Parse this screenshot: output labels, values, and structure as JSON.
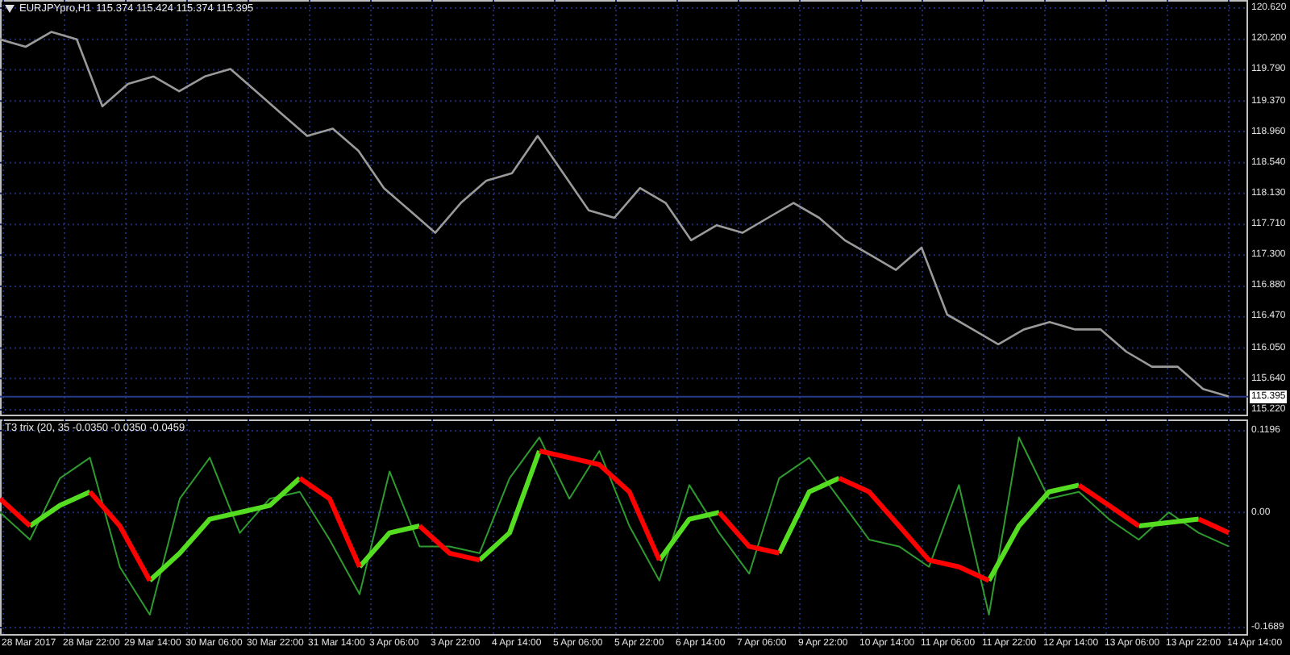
{
  "main_chart": {
    "header": {
      "quotes": "115.374 115.424 115.374 115.395"
    },
    "chart_data": {
      "type": "line",
      "grid": true,
      "ylim": [
        115.22,
        120.62
      ],
      "yticks": [
        {
          "value": 120.62,
          "label": "120.620"
        },
        {
          "value": 120.2,
          "label": "120.200"
        },
        {
          "value": 119.79,
          "label": "119.790"
        },
        {
          "value": 119.37,
          "label": "119.370"
        },
        {
          "value": 118.96,
          "label": "118.960"
        },
        {
          "value": 118.54,
          "label": "118.540"
        },
        {
          "value": 118.13,
          "label": "118.130"
        },
        {
          "value": 117.71,
          "label": "117.710"
        },
        {
          "value": 117.3,
          "label": "117.300"
        },
        {
          "value": 116.88,
          "label": "116.880"
        },
        {
          "value": 116.47,
          "label": "116.470"
        },
        {
          "value": 116.05,
          "label": "116.050"
        },
        {
          "value": 115.64,
          "label": "115.640"
        },
        {
          "value": 115.22,
          "label": "115.220"
        }
      ],
      "ref_lines": [
        {
          "axis": "y",
          "value": 115.395,
          "label": "115.395",
          "color": "#2a3a8a"
        }
      ],
      "series": [
        {
          "name": "EURJPYpro,H1",
          "color": "#9a9a9a",
          "values": [
            120.2,
            120.1,
            120.3,
            120.2,
            119.3,
            119.6,
            119.7,
            119.5,
            119.7,
            119.8,
            119.5,
            119.2,
            118.9,
            119.0,
            118.7,
            118.2,
            117.9,
            117.6,
            118.0,
            118.3,
            118.4,
            118.9,
            118.4,
            117.9,
            117.8,
            118.2,
            118.0,
            117.5,
            117.7,
            117.6,
            117.8,
            118.0,
            117.8,
            117.5,
            117.3,
            117.1,
            117.4,
            116.5,
            116.3,
            116.1,
            116.3,
            116.4,
            116.3,
            116.3,
            116.0,
            115.8,
            115.8,
            115.5,
            115.4
          ]
        }
      ]
    }
  },
  "indicator": {
    "label": "T3 trix (20, 35 -0.0350 -0.0350 -0.0459",
    "chart_data": {
      "type": "line",
      "grid": true,
      "ylim": [
        -0.1689,
        0.1196
      ],
      "yticks": [
        {
          "value": 0.1196,
          "label": "0.1196"
        },
        {
          "value": 0,
          "label": "0.00"
        },
        {
          "value": -0.1689,
          "label": "-0.1689"
        }
      ],
      "series": [
        {
          "color": "#2f9a2f",
          "values": [
            0.0,
            -0.04,
            0.05,
            0.08,
            -0.08,
            -0.15,
            0.02,
            0.08,
            -0.03,
            0.02,
            0.03,
            -0.04,
            -0.12,
            0.06,
            -0.05,
            -0.05,
            -0.06,
            0.05,
            0.11,
            0.02,
            0.09,
            -0.02,
            -0.1,
            0.04,
            -0.03,
            -0.09,
            0.05,
            0.08,
            0.02,
            -0.04,
            -0.05,
            -0.08,
            0.04,
            -0.15,
            0.11,
            0.02,
            0.03,
            -0.01,
            -0.04,
            0.0,
            -0.03,
            -0.05
          ]
        },
        {
          "color": "#55dd22",
          "values": [
            null,
            -0.02,
            0.01,
            0.03,
            null,
            -0.1,
            -0.06,
            -0.01,
            0.0,
            0.01,
            0.05,
            null,
            -0.08,
            -0.03,
            -0.02,
            null,
            -0.07,
            -0.03,
            0.09,
            null,
            null,
            null,
            -0.07,
            -0.01,
            0.0,
            null,
            -0.06,
            0.03,
            0.05,
            null,
            null,
            null,
            null,
            -0.1,
            -0.02,
            0.03,
            0.04,
            null,
            -0.02,
            -0.015,
            -0.01,
            null
          ]
        },
        {
          "color": "#ff0000",
          "values": [
            0.02,
            -0.02,
            null,
            0.03,
            -0.02,
            -0.1,
            null,
            null,
            null,
            null,
            0.05,
            0.02,
            -0.08,
            null,
            -0.02,
            -0.06,
            -0.07,
            null,
            0.09,
            0.08,
            0.07,
            0.03,
            -0.07,
            null,
            0.0,
            -0.05,
            -0.06,
            null,
            0.05,
            0.03,
            -0.02,
            -0.07,
            -0.08,
            -0.1,
            null,
            null,
            0.04,
            0.01,
            -0.02,
            null,
            -0.01,
            -0.03
          ]
        }
      ]
    }
  },
  "time_axis": [
    "28 Mar 2017",
    "28 Mar 22:00",
    "29 Mar 14:00",
    "30 Mar 06:00",
    "30 Mar 22:00",
    "31 Mar 14:00",
    "3 Apr 06:00",
    "3 Apr 22:00",
    "4 Apr 14:00",
    "5 Apr 06:00",
    "5 Apr 22:00",
    "6 Apr 14:00",
    "7 Apr 06:00",
    "9 Apr 22:00",
    "10 Apr 14:00",
    "11 Apr 06:00",
    "11 Apr 22:00",
    "12 Apr 14:00",
    "13 Apr 06:00",
    "13 Apr 22:00",
    "14 Apr 14:00"
  ]
}
